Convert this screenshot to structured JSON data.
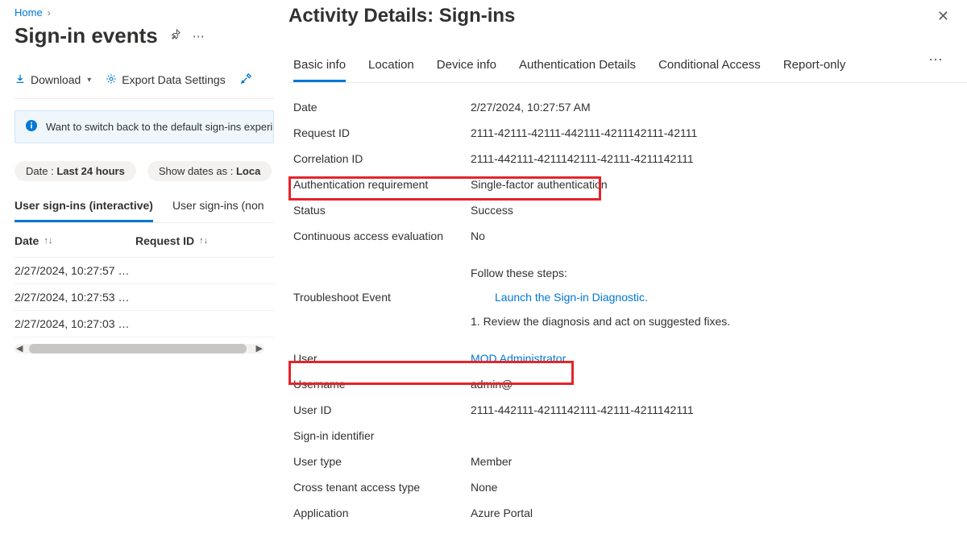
{
  "breadcrumb": {
    "home": "Home"
  },
  "page_title": "Sign-in events",
  "toolbar": {
    "download": "Download",
    "export": "Export Data Settings"
  },
  "banner": "Want to switch back to the default sign-ins experi",
  "filters": {
    "date_label": "Date :",
    "date_value": "Last 24 hours",
    "show_label": "Show dates as :",
    "show_value": "Loca"
  },
  "tabs": {
    "interactive": "User sign-ins (interactive)",
    "noninteractive": "User sign-ins (non"
  },
  "table": {
    "col_date": "Date",
    "col_req": "Request ID",
    "rows": [
      {
        "date": "2/27/2024, 10:27:57 …",
        "req": ""
      },
      {
        "date": "2/27/2024, 10:27:53 …",
        "req": ""
      },
      {
        "date": "2/27/2024, 10:27:03 …",
        "req": ""
      }
    ]
  },
  "details": {
    "title": "Activity Details: Sign-ins",
    "tabs": {
      "basic": "Basic info",
      "location": "Location",
      "device": "Device info",
      "auth": "Authentication Details",
      "conditional": "Conditional Access",
      "report": "Report-only"
    },
    "kv": {
      "date_k": "Date",
      "date_v": "2/27/2024, 10:27:57 AM",
      "reqid_k": "Request ID",
      "reqid_v": "2111-42111-42111-442111-4211142111-42111",
      "corr_k": "Correlation ID",
      "corr_v": "2111-442111-4211142111-42111-4211142111",
      "authreq_k": "Authentication requirement",
      "authreq_v": "Single-factor authentication",
      "status_k": "Status",
      "status_v": "Success",
      "cae_k": "Continuous access evaluation",
      "cae_v": "No",
      "trouble_k": "Troubleshoot Event",
      "trouble_follow": "Follow these steps:",
      "trouble_link": "Launch the Sign-in Diagnostic.",
      "trouble_step1": "1. Review the diagnosis and act on suggested fixes.",
      "user_k": "User",
      "user_v": "MOD Administrator",
      "username_k": "Username",
      "username_v": "admin@",
      "userid_k": "User ID",
      "userid_v": "2111-442111-4211142111-42111-4211142111",
      "signinid_k": "Sign-in identifier",
      "signinid_v": "",
      "usertype_k": "User type",
      "usertype_v": "Member",
      "cross_k": "Cross tenant access type",
      "cross_v": "None",
      "app_k": "Application",
      "app_v": "Azure Portal"
    }
  }
}
